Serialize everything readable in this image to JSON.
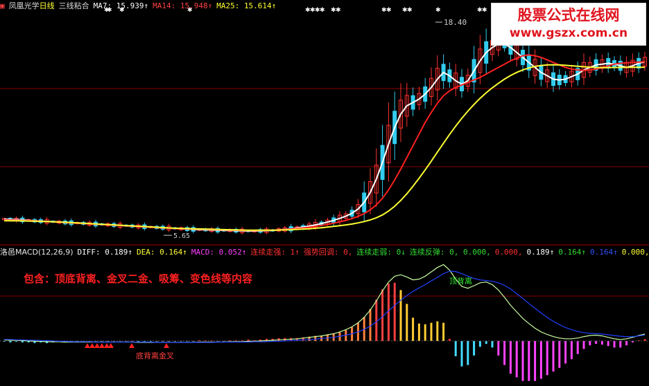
{
  "header": {
    "stock_name": "凤凰光学",
    "period": "日线",
    "indicator": "三线粘合",
    "ma7": "MA7: 15.939↑",
    "ma14": "MA14: 15.948↑",
    "ma25": "MA25: 15.614↑"
  },
  "macd_header": {
    "title": "洛邑MACD(12,26,9)",
    "diff": "DIFF: 0.189↑",
    "dea": "DEA: 0.164↑",
    "macd": "MACD: 0.052↑",
    "lianxu_zouqiang": "连续走强: 1↑",
    "qiangshi_huitiao": "强势回调: 0,",
    "lianxu_zouruo": "连续走弱: 0↓",
    "lianxu_fantan": "连续反弹: 0, 0.000,",
    "v_zero": "0.000,",
    "v_diff": "0.189↑",
    "v_dea": "0.164↑",
    "v_macd": "0.164↑",
    "v_tail": "0.000, 0.0"
  },
  "annotations": {
    "high_label": "18.40",
    "low_label": "5.65",
    "description": "包含：顶底背离、金叉二金、吸筹、变色线等内容",
    "top_divergence": "顶背离",
    "bottom_signal": "底背离金叉"
  },
  "watermark": {
    "title": "股票公式在线网",
    "url": "www.gszx.com.cn"
  },
  "colors": {
    "background": "#000000",
    "ma7": "#ffffff",
    "ma14": "#ff2020",
    "ma25": "#ffff33",
    "up_candle": "#ff3030",
    "down_candle": "#33ccee",
    "diff": "#c8ffa0",
    "dea": "#2040ff",
    "grid": "#880000"
  },
  "chart_data": [
    {
      "type": "candlestick",
      "title": "凤凰光学 日线 三线粘合",
      "series": [
        {
          "name": "MA7",
          "values": [
            6.5,
            6.48,
            6.47,
            6.45,
            6.43,
            6.4,
            6.38,
            6.36,
            6.34,
            6.32,
            6.3,
            6.28,
            6.26,
            6.24,
            6.22,
            6.2,
            6.18,
            6.16,
            6.14,
            6.12,
            6.1,
            6.08,
            6.06,
            6.04,
            6.02,
            6.0,
            5.98,
            5.96,
            5.94,
            5.92,
            5.9,
            5.88,
            5.86,
            5.85,
            5.84,
            5.83,
            5.82,
            5.81,
            5.8,
            5.79,
            5.78,
            5.78,
            5.79,
            5.8,
            5.82,
            5.85,
            5.88,
            5.92,
            5.97,
            6.02,
            6.08,
            6.15,
            6.23,
            6.32,
            6.42,
            6.54,
            6.68,
            6.85,
            7.1,
            7.5,
            8.1,
            8.9,
            9.9,
            11.0,
            12.0,
            12.8,
            13.3,
            13.5,
            13.7,
            14.0,
            14.4,
            14.9,
            15.3,
            15.1,
            14.8,
            14.6,
            14.8,
            15.4,
            16.0,
            16.5,
            16.8,
            17.0,
            17.0,
            16.8,
            16.5,
            16.2,
            15.9,
            15.6,
            15.3,
            15.1,
            14.9,
            14.85,
            14.9,
            15.05,
            15.2,
            15.45,
            15.6,
            15.75,
            15.8,
            15.85,
            15.8,
            15.7,
            15.6,
            15.7,
            15.85,
            15.94
          ]
        },
        {
          "name": "MA14",
          "values": [
            6.45,
            6.44,
            6.43,
            6.42,
            6.41,
            6.39,
            6.37,
            6.35,
            6.33,
            6.31,
            6.29,
            6.27,
            6.25,
            6.23,
            6.21,
            6.19,
            6.17,
            6.15,
            6.13,
            6.11,
            6.09,
            6.07,
            6.05,
            6.03,
            6.01,
            5.99,
            5.97,
            5.95,
            5.93,
            5.92,
            5.91,
            5.9,
            5.89,
            5.88,
            5.87,
            5.86,
            5.85,
            5.84,
            5.83,
            5.82,
            5.81,
            5.81,
            5.81,
            5.82,
            5.83,
            5.85,
            5.87,
            5.9,
            5.93,
            5.97,
            6.01,
            6.06,
            6.12,
            6.18,
            6.25,
            6.33,
            6.42,
            6.53,
            6.66,
            6.83,
            7.05,
            7.35,
            7.75,
            8.25,
            8.85,
            9.5,
            10.2,
            10.9,
            11.6,
            12.3,
            12.9,
            13.45,
            13.9,
            14.2,
            14.4,
            14.55,
            14.7,
            14.85,
            15.0,
            15.2,
            15.4,
            15.6,
            15.8,
            16.0,
            16.15,
            16.3,
            16.35,
            16.3,
            16.2,
            16.05,
            15.9,
            15.75,
            15.6,
            15.5,
            15.45,
            15.42,
            15.45,
            15.5,
            15.6,
            15.7,
            15.8,
            15.85,
            15.88,
            15.9,
            15.92,
            15.948
          ]
        },
        {
          "name": "MA25",
          "values": [
            6.4,
            6.4,
            6.39,
            6.39,
            6.38,
            6.37,
            6.36,
            6.35,
            6.34,
            6.32,
            6.31,
            6.29,
            6.27,
            6.25,
            6.23,
            6.21,
            6.19,
            6.17,
            6.15,
            6.13,
            6.11,
            6.09,
            6.07,
            6.05,
            6.03,
            6.01,
            5.99,
            5.97,
            5.95,
            5.94,
            5.93,
            5.92,
            5.91,
            5.9,
            5.89,
            5.88,
            5.87,
            5.86,
            5.85,
            5.84,
            5.83,
            5.83,
            5.83,
            5.83,
            5.83,
            5.84,
            5.85,
            5.86,
            5.88,
            5.9,
            5.92,
            5.95,
            5.98,
            6.02,
            6.06,
            6.1,
            6.15,
            6.2,
            6.27,
            6.35,
            6.45,
            6.58,
            6.75,
            6.98,
            7.27,
            7.62,
            8.02,
            8.47,
            8.95,
            9.45,
            9.98,
            10.52,
            11.05,
            11.58,
            12.08,
            12.55,
            12.98,
            13.38,
            13.75,
            14.08,
            14.38,
            14.65,
            14.9,
            15.12,
            15.3,
            15.45,
            15.57,
            15.66,
            15.72,
            15.75,
            15.76,
            15.75,
            15.73,
            15.7,
            15.67,
            15.64,
            15.62,
            15.6,
            15.59,
            15.59,
            15.6,
            15.6,
            15.61,
            15.61,
            15.61,
            15.614
          ]
        }
      ],
      "annotations": [
        {
          "label": "18.40",
          "value": 18.4
        },
        {
          "label": "5.65",
          "value": 5.65
        }
      ]
    },
    {
      "type": "bar",
      "title": "洛邑MACD(12,26,9)",
      "x": "bar index",
      "series": [
        {
          "name": "DIFF",
          "values": [
            0.03,
            0.02,
            0.02,
            0.01,
            0.0,
            -0.01,
            -0.01,
            -0.02,
            -0.02,
            -0.02,
            -0.03,
            -0.03,
            -0.03,
            -0.03,
            -0.03,
            -0.03,
            -0.03,
            -0.03,
            -0.03,
            -0.03,
            -0.03,
            -0.03,
            -0.04,
            -0.04,
            -0.04,
            -0.04,
            -0.04,
            -0.04,
            -0.04,
            -0.04,
            -0.04,
            -0.04,
            -0.03,
            -0.03,
            -0.03,
            -0.03,
            -0.03,
            -0.02,
            -0.02,
            -0.02,
            -0.01,
            -0.01,
            0.0,
            0.01,
            0.02,
            0.03,
            0.04,
            0.05,
            0.06,
            0.08,
            0.1,
            0.12,
            0.14,
            0.17,
            0.2,
            0.25,
            0.31,
            0.39,
            0.5,
            0.65,
            0.85,
            1.1,
            1.38,
            1.62,
            1.78,
            1.82,
            1.76,
            1.68,
            1.7,
            1.78,
            1.9,
            2.02,
            2.1,
            1.95,
            1.7,
            1.5,
            1.45,
            1.52,
            1.6,
            1.62,
            1.55,
            1.4,
            1.2,
            0.98,
            0.8,
            0.62,
            0.48,
            0.35,
            0.25,
            0.18,
            0.12,
            0.08,
            0.06,
            0.06,
            0.08,
            0.12,
            0.15,
            0.16,
            0.14,
            0.1,
            0.06,
            0.04,
            0.06,
            0.1,
            0.15,
            0.189
          ]
        },
        {
          "name": "DEA",
          "values": [
            0.04,
            0.04,
            0.03,
            0.03,
            0.02,
            0.02,
            0.01,
            0.01,
            0.0,
            -0.01,
            -0.01,
            -0.02,
            -0.02,
            -0.02,
            -0.02,
            -0.03,
            -0.03,
            -0.03,
            -0.03,
            -0.03,
            -0.03,
            -0.03,
            -0.03,
            -0.03,
            -0.03,
            -0.04,
            -0.04,
            -0.04,
            -0.04,
            -0.04,
            -0.04,
            -0.04,
            -0.04,
            -0.04,
            -0.04,
            -0.03,
            -0.03,
            -0.03,
            -0.03,
            -0.03,
            -0.03,
            -0.02,
            -0.02,
            -0.02,
            -0.01,
            -0.01,
            0.0,
            0.01,
            0.02,
            0.03,
            0.04,
            0.05,
            0.07,
            0.08,
            0.1,
            0.13,
            0.16,
            0.2,
            0.25,
            0.32,
            0.41,
            0.53,
            0.67,
            0.83,
            0.98,
            1.12,
            1.25,
            1.36,
            1.46,
            1.55,
            1.65,
            1.75,
            1.85,
            1.92,
            1.91,
            1.85,
            1.78,
            1.72,
            1.68,
            1.66,
            1.64,
            1.6,
            1.53,
            1.43,
            1.3,
            1.17,
            1.03,
            0.9,
            0.77,
            0.65,
            0.54,
            0.45,
            0.37,
            0.31,
            0.26,
            0.23,
            0.21,
            0.2,
            0.19,
            0.17,
            0.15,
            0.13,
            0.12,
            0.12,
            0.14,
            0.164
          ]
        },
        {
          "name": "MACD",
          "values": [
            -0.02,
            -0.04,
            -0.02,
            -0.04,
            -0.04,
            -0.06,
            -0.04,
            -0.06,
            -0.04,
            -0.02,
            -0.04,
            -0.02,
            -0.02,
            -0.02,
            -0.02,
            0.0,
            0.0,
            0.0,
            0.0,
            0.0,
            0.0,
            0.0,
            -0.02,
            -0.02,
            -0.02,
            0.0,
            0.0,
            0.0,
            0.0,
            0.0,
            0.0,
            0.0,
            0.02,
            0.02,
            0.02,
            0.0,
            0.0,
            0.02,
            0.02,
            0.02,
            0.04,
            0.02,
            0.04,
            0.06,
            0.06,
            0.08,
            0.08,
            0.08,
            0.08,
            0.1,
            0.12,
            0.14,
            0.14,
            0.18,
            0.2,
            0.24,
            0.3,
            0.38,
            0.5,
            0.66,
            0.88,
            1.14,
            1.42,
            1.58,
            1.6,
            1.4,
            1.02,
            0.64,
            0.48,
            0.46,
            0.5,
            0.54,
            0.5,
            0.06,
            -0.42,
            -0.7,
            -0.66,
            -0.4,
            -0.16,
            -0.08,
            -0.18,
            -0.4,
            -0.66,
            -0.9,
            -1.0,
            -1.1,
            -1.1,
            -1.1,
            -1.04,
            -0.94,
            -0.84,
            -0.74,
            -0.62,
            -0.5,
            -0.36,
            -0.22,
            -0.12,
            -0.08,
            -0.1,
            -0.14,
            -0.18,
            -0.18,
            -0.12,
            -0.04,
            0.02,
            0.052
          ]
        }
      ],
      "annotations": [
        {
          "label": "顶背离"
        },
        {
          "label": "底背离金叉"
        }
      ]
    }
  ]
}
